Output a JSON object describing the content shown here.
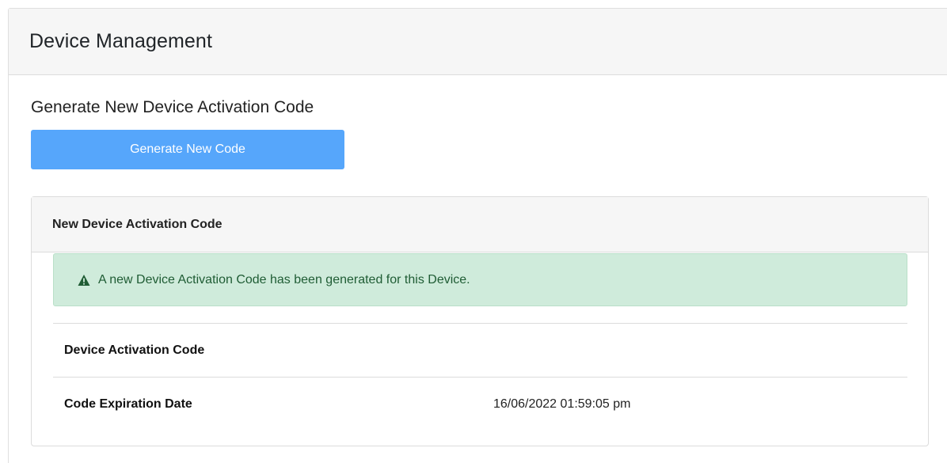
{
  "header": {
    "title": "Device Management"
  },
  "generate_section": {
    "title": "Generate New Device Activation Code",
    "button_label": "Generate New Code",
    "button_color": "#56a6fb"
  },
  "code_panel": {
    "title": "New Device Activation Code",
    "alert": {
      "icon": "warning-triangle-icon",
      "message": "A new Device Activation Code has been generated for this Device.",
      "background": "#cfebdb",
      "text_color": "#1f5c34"
    },
    "rows": [
      {
        "label": "Device Activation Code",
        "value": ""
      },
      {
        "label": "Code Expiration Date",
        "value": "16/06/2022 01:59:05 pm"
      }
    ]
  }
}
